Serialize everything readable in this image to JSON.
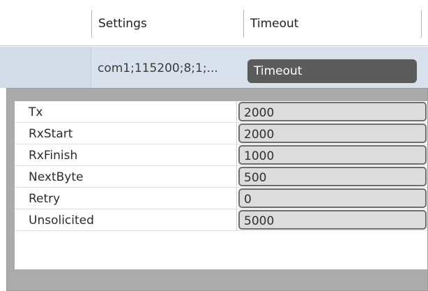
{
  "columns": {
    "settings": "Settings",
    "timeout": "Timeout"
  },
  "row": {
    "settings_value": "com1;115200;8;1;...",
    "timeout_button": "Timeout"
  },
  "timeout_properties": [
    {
      "label": "Tx",
      "value": "2000"
    },
    {
      "label": "RxStart",
      "value": "2000"
    },
    {
      "label": "RxFinish",
      "value": "1000"
    },
    {
      "label": "NextByte",
      "value": "500"
    },
    {
      "label": "Retry",
      "value": "0"
    },
    {
      "label": "Unsolicited",
      "value": "5000"
    }
  ],
  "colors": {
    "selected_row": "#d9e1ec",
    "button_bg": "#5b5b5b",
    "panel_bg": "#ababab",
    "field_bg": "#dcdcdc"
  }
}
